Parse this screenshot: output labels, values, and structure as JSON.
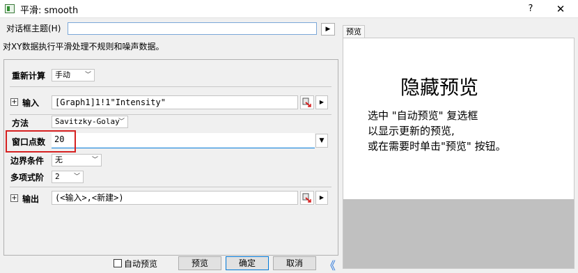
{
  "window": {
    "title": "平滑: smooth",
    "help": "?",
    "close": "✕"
  },
  "theme": {
    "label": "对话框主题(H)",
    "value": "",
    "arrow": "▶"
  },
  "description": "对XY数据执行平滑处理不规则和噪声数据。",
  "recalc": {
    "label": "重新计算",
    "value": "手动"
  },
  "input": {
    "label": "输入",
    "value": "[Graph1]1!1\"Intensity\""
  },
  "method": {
    "label": "方法",
    "value": "Savitzky-Golay"
  },
  "window_points": {
    "label": "窗口点数",
    "value": "20"
  },
  "boundary": {
    "label": "边界条件",
    "value": "无"
  },
  "poly_order": {
    "label": "多项式阶",
    "value": "2"
  },
  "output": {
    "label": "输出",
    "value": "(<输入>,<新建>)"
  },
  "preview": {
    "tab": "预览",
    "heading": "隐藏预览",
    "lines": [
      "选中 \"自动预览\" 复选框",
      "以显示更新的预览,",
      "或在需要时单击\"预览\" 按钮。"
    ]
  },
  "footer": {
    "auto_preview": "自动预览",
    "preview_btn": "预览",
    "ok_btn": "确定",
    "cancel_btn": "取消",
    "collapse": "《"
  },
  "colors": {
    "highlight": "#d62020",
    "accent": "#1e6fd9",
    "preview_gray": "#c0c0c0"
  }
}
